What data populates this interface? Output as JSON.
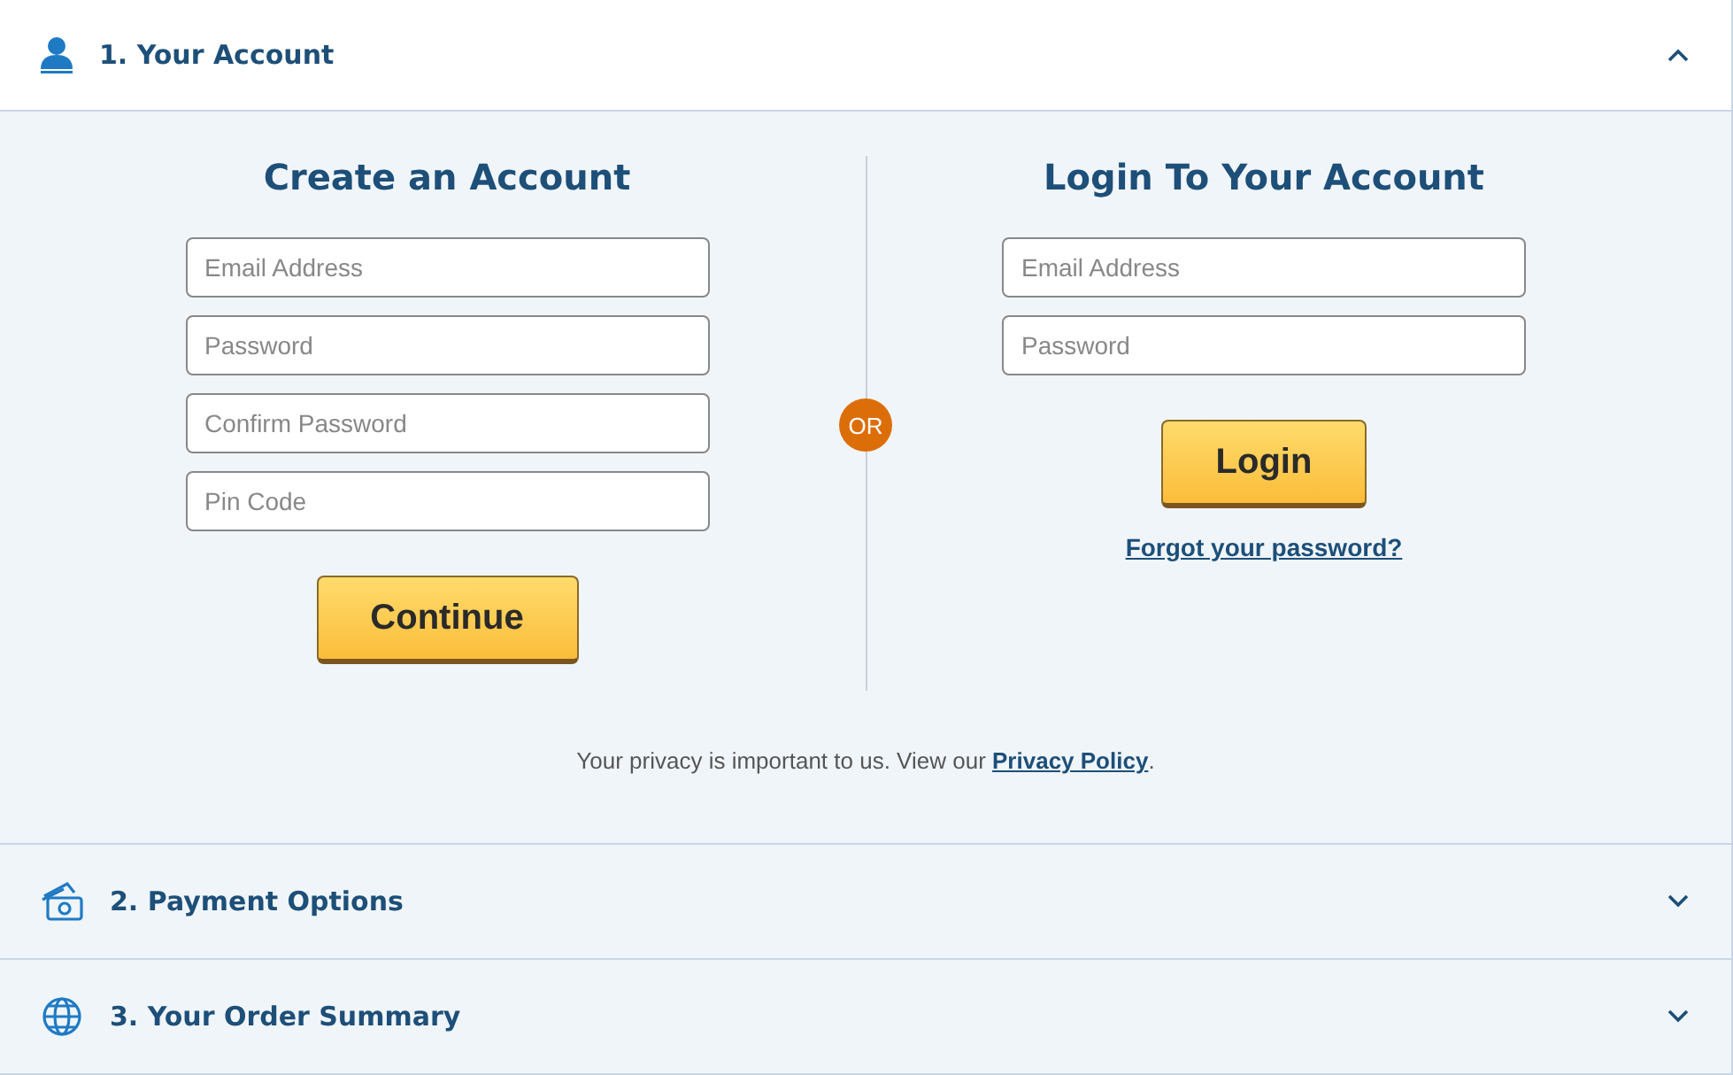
{
  "sections": [
    {
      "kind": "user",
      "title": "1. Your Account",
      "expanded": true
    },
    {
      "kind": "cash",
      "title": "2. Payment Options",
      "expanded": false
    },
    {
      "kind": "globe",
      "title": "3. Your Order Summary",
      "expanded": false
    }
  ],
  "create": {
    "title": "Create an Account",
    "fields": [
      {
        "placeholder": "Email Address"
      },
      {
        "placeholder": "Password"
      },
      {
        "placeholder": "Confirm Password"
      },
      {
        "placeholder": "Pin Code"
      }
    ],
    "button": "Continue"
  },
  "divider_label": "OR",
  "login": {
    "title": "Login To Your Account",
    "fields": [
      {
        "placeholder": "Email Address"
      },
      {
        "placeholder": "Password"
      }
    ],
    "button": "Login",
    "forgot_link": "Forgot your password?"
  },
  "privacy": {
    "before": "Your privacy is important to us. View our ",
    "link": "Privacy Policy",
    "after": "."
  }
}
